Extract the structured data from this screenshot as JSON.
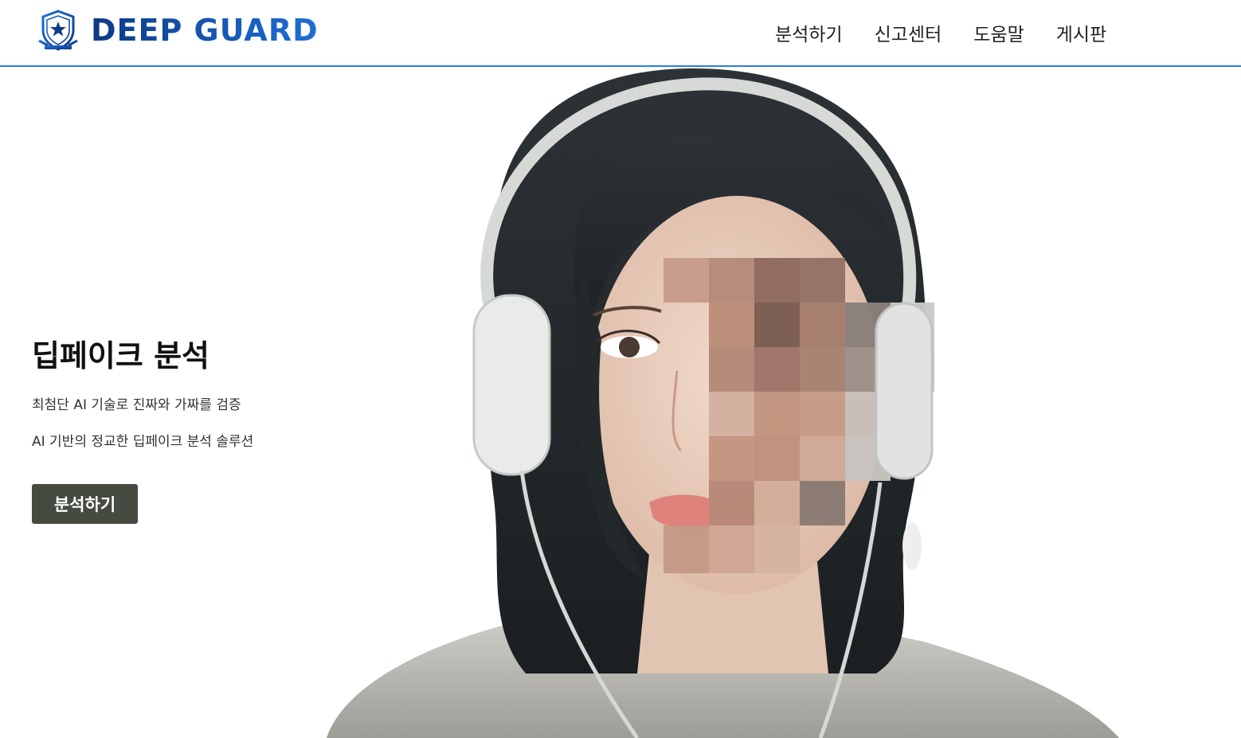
{
  "header": {
    "logo_text": "DEEP GUARD",
    "logo_icon": "shield-star-icon",
    "brand_colors": [
      "#0c3a86",
      "#1f6fd6"
    ],
    "divider_color": "#2b7de0"
  },
  "nav": {
    "items": [
      {
        "label": "분석하기"
      },
      {
        "label": "신고센터"
      },
      {
        "label": "도움말"
      },
      {
        "label": "게시판"
      }
    ]
  },
  "hero": {
    "title": "딥페이크 분석",
    "subtitle_1": "최첨단 AI 기술로 진짜와 가짜를 검증",
    "subtitle_2": "AI 기반의 정교한 딥페이크 분석 솔루션",
    "cta_label": "분석하기",
    "cta_color": "#454b40",
    "image": "portrait of a woman wearing white headphones with half of the face pixelated"
  }
}
